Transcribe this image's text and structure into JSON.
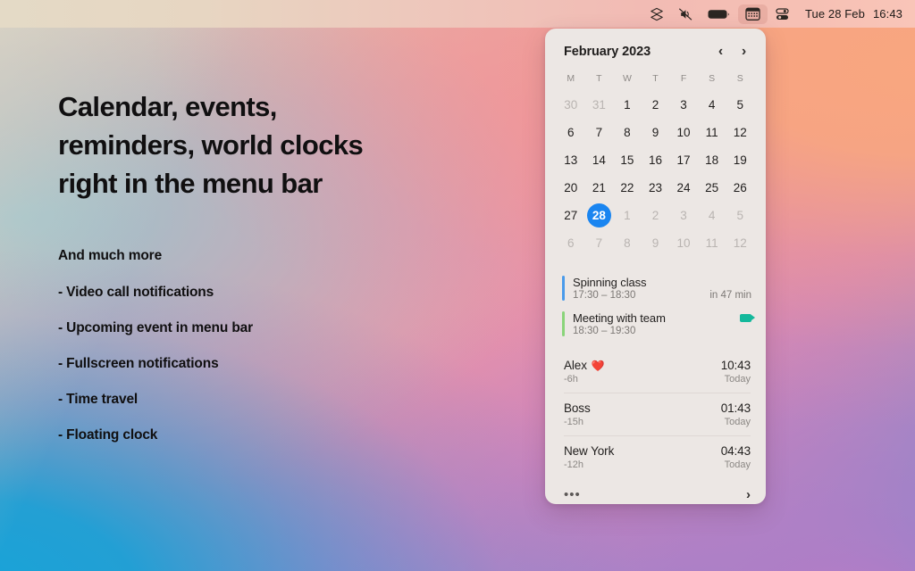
{
  "menubar": {
    "icons": [
      {
        "name": "dropbox-icon",
        "label": "Dropbox"
      },
      {
        "name": "volume-muted-icon",
        "label": "Volume muted"
      },
      {
        "name": "battery-icon",
        "label": "Battery"
      },
      {
        "name": "calendar-icon",
        "label": "Calendar",
        "active": true
      },
      {
        "name": "control-center-icon",
        "label": "Control Center"
      }
    ],
    "date": "Tue 28 Feb",
    "time": "16:43"
  },
  "hero": {
    "headline": "Calendar, events,\nreminders, world clocks\nright in the menu bar"
  },
  "features": {
    "heading": "And much more",
    "items": [
      "- Video call notifications",
      "- Upcoming event in menu bar",
      "- Fullscreen notifications",
      "- Time travel",
      "- Floating clock"
    ]
  },
  "panel": {
    "calendar": {
      "title": "February 2023",
      "prev_label": "‹",
      "next_label": "›",
      "day_headers": [
        "M",
        "T",
        "W",
        "T",
        "F",
        "S",
        "S"
      ],
      "weeks": [
        [
          {
            "d": "30",
            "muted": true
          },
          {
            "d": "31",
            "muted": true
          },
          {
            "d": "1"
          },
          {
            "d": "2"
          },
          {
            "d": "3"
          },
          {
            "d": "4"
          },
          {
            "d": "5"
          }
        ],
        [
          {
            "d": "6"
          },
          {
            "d": "7"
          },
          {
            "d": "8"
          },
          {
            "d": "9"
          },
          {
            "d": "10"
          },
          {
            "d": "11"
          },
          {
            "d": "12"
          }
        ],
        [
          {
            "d": "13"
          },
          {
            "d": "14"
          },
          {
            "d": "15"
          },
          {
            "d": "16"
          },
          {
            "d": "17"
          },
          {
            "d": "18"
          },
          {
            "d": "19"
          }
        ],
        [
          {
            "d": "20"
          },
          {
            "d": "21"
          },
          {
            "d": "22"
          },
          {
            "d": "23"
          },
          {
            "d": "24"
          },
          {
            "d": "25"
          },
          {
            "d": "26"
          }
        ],
        [
          {
            "d": "27"
          },
          {
            "d": "28",
            "today": true
          },
          {
            "d": "1",
            "muted": true
          },
          {
            "d": "2",
            "muted": true
          },
          {
            "d": "3",
            "muted": true
          },
          {
            "d": "4",
            "muted": true
          },
          {
            "d": "5",
            "muted": true
          }
        ],
        [
          {
            "d": "6",
            "muted": true
          },
          {
            "d": "7",
            "muted": true
          },
          {
            "d": "8",
            "muted": true
          },
          {
            "d": "9",
            "muted": true
          },
          {
            "d": "10",
            "muted": true
          },
          {
            "d": "11",
            "muted": true
          },
          {
            "d": "12",
            "muted": true
          }
        ]
      ],
      "today_accent": "#1a85f0"
    },
    "events": [
      {
        "title": "Spinning class",
        "time": "17:30 – 18:30",
        "right_text": "in 47 min",
        "color": "#4a9bea",
        "has_video": false
      },
      {
        "title": "Meeting with team",
        "time": "18:30 – 19:30",
        "right_text": "",
        "color": "#8ad47a",
        "has_video": true,
        "video_color": "#14b89b"
      }
    ],
    "clocks": [
      {
        "name": "Alex",
        "emoji": "❤️",
        "offset": "-6h",
        "time": "10:43",
        "day": "Today"
      },
      {
        "name": "Boss",
        "emoji": "",
        "offset": "-15h",
        "time": "01:43",
        "day": "Today"
      },
      {
        "name": "New York",
        "emoji": "",
        "offset": "-12h",
        "time": "04:43",
        "day": "Today"
      }
    ],
    "footer": {
      "more_label": "•••",
      "chevron_label": "›"
    }
  },
  "colors": {
    "panel_bg": "#ece7e4",
    "accent_blue": "#1a85f0",
    "menubar_start": "#e4dac6",
    "menubar_end": "#f9c5b8"
  }
}
